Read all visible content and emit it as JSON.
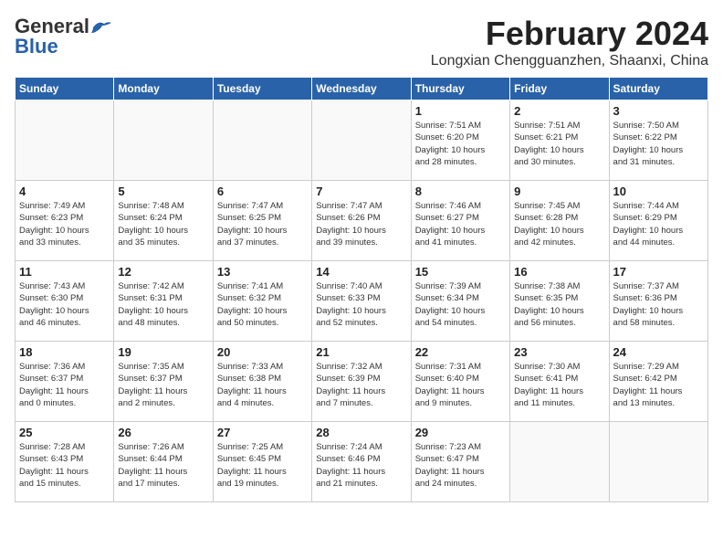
{
  "header": {
    "logo_general": "General",
    "logo_blue": "Blue",
    "month": "February 2024",
    "location": "Longxian Chengguanzhen, Shaanxi, China"
  },
  "days_of_week": [
    "Sunday",
    "Monday",
    "Tuesday",
    "Wednesday",
    "Thursday",
    "Friday",
    "Saturday"
  ],
  "weeks": [
    [
      {
        "day": "",
        "info": ""
      },
      {
        "day": "",
        "info": ""
      },
      {
        "day": "",
        "info": ""
      },
      {
        "day": "",
        "info": ""
      },
      {
        "day": "1",
        "info": "Sunrise: 7:51 AM\nSunset: 6:20 PM\nDaylight: 10 hours\nand 28 minutes."
      },
      {
        "day": "2",
        "info": "Sunrise: 7:51 AM\nSunset: 6:21 PM\nDaylight: 10 hours\nand 30 minutes."
      },
      {
        "day": "3",
        "info": "Sunrise: 7:50 AM\nSunset: 6:22 PM\nDaylight: 10 hours\nand 31 minutes."
      }
    ],
    [
      {
        "day": "4",
        "info": "Sunrise: 7:49 AM\nSunset: 6:23 PM\nDaylight: 10 hours\nand 33 minutes."
      },
      {
        "day": "5",
        "info": "Sunrise: 7:48 AM\nSunset: 6:24 PM\nDaylight: 10 hours\nand 35 minutes."
      },
      {
        "day": "6",
        "info": "Sunrise: 7:47 AM\nSunset: 6:25 PM\nDaylight: 10 hours\nand 37 minutes."
      },
      {
        "day": "7",
        "info": "Sunrise: 7:47 AM\nSunset: 6:26 PM\nDaylight: 10 hours\nand 39 minutes."
      },
      {
        "day": "8",
        "info": "Sunrise: 7:46 AM\nSunset: 6:27 PM\nDaylight: 10 hours\nand 41 minutes."
      },
      {
        "day": "9",
        "info": "Sunrise: 7:45 AM\nSunset: 6:28 PM\nDaylight: 10 hours\nand 42 minutes."
      },
      {
        "day": "10",
        "info": "Sunrise: 7:44 AM\nSunset: 6:29 PM\nDaylight: 10 hours\nand 44 minutes."
      }
    ],
    [
      {
        "day": "11",
        "info": "Sunrise: 7:43 AM\nSunset: 6:30 PM\nDaylight: 10 hours\nand 46 minutes."
      },
      {
        "day": "12",
        "info": "Sunrise: 7:42 AM\nSunset: 6:31 PM\nDaylight: 10 hours\nand 48 minutes."
      },
      {
        "day": "13",
        "info": "Sunrise: 7:41 AM\nSunset: 6:32 PM\nDaylight: 10 hours\nand 50 minutes."
      },
      {
        "day": "14",
        "info": "Sunrise: 7:40 AM\nSunset: 6:33 PM\nDaylight: 10 hours\nand 52 minutes."
      },
      {
        "day": "15",
        "info": "Sunrise: 7:39 AM\nSunset: 6:34 PM\nDaylight: 10 hours\nand 54 minutes."
      },
      {
        "day": "16",
        "info": "Sunrise: 7:38 AM\nSunset: 6:35 PM\nDaylight: 10 hours\nand 56 minutes."
      },
      {
        "day": "17",
        "info": "Sunrise: 7:37 AM\nSunset: 6:36 PM\nDaylight: 10 hours\nand 58 minutes."
      }
    ],
    [
      {
        "day": "18",
        "info": "Sunrise: 7:36 AM\nSunset: 6:37 PM\nDaylight: 11 hours\nand 0 minutes."
      },
      {
        "day": "19",
        "info": "Sunrise: 7:35 AM\nSunset: 6:37 PM\nDaylight: 11 hours\nand 2 minutes."
      },
      {
        "day": "20",
        "info": "Sunrise: 7:33 AM\nSunset: 6:38 PM\nDaylight: 11 hours\nand 4 minutes."
      },
      {
        "day": "21",
        "info": "Sunrise: 7:32 AM\nSunset: 6:39 PM\nDaylight: 11 hours\nand 7 minutes."
      },
      {
        "day": "22",
        "info": "Sunrise: 7:31 AM\nSunset: 6:40 PM\nDaylight: 11 hours\nand 9 minutes."
      },
      {
        "day": "23",
        "info": "Sunrise: 7:30 AM\nSunset: 6:41 PM\nDaylight: 11 hours\nand 11 minutes."
      },
      {
        "day": "24",
        "info": "Sunrise: 7:29 AM\nSunset: 6:42 PM\nDaylight: 11 hours\nand 13 minutes."
      }
    ],
    [
      {
        "day": "25",
        "info": "Sunrise: 7:28 AM\nSunset: 6:43 PM\nDaylight: 11 hours\nand 15 minutes."
      },
      {
        "day": "26",
        "info": "Sunrise: 7:26 AM\nSunset: 6:44 PM\nDaylight: 11 hours\nand 17 minutes."
      },
      {
        "day": "27",
        "info": "Sunrise: 7:25 AM\nSunset: 6:45 PM\nDaylight: 11 hours\nand 19 minutes."
      },
      {
        "day": "28",
        "info": "Sunrise: 7:24 AM\nSunset: 6:46 PM\nDaylight: 11 hours\nand 21 minutes."
      },
      {
        "day": "29",
        "info": "Sunrise: 7:23 AM\nSunset: 6:47 PM\nDaylight: 11 hours\nand 24 minutes."
      },
      {
        "day": "",
        "info": ""
      },
      {
        "day": "",
        "info": ""
      }
    ]
  ]
}
